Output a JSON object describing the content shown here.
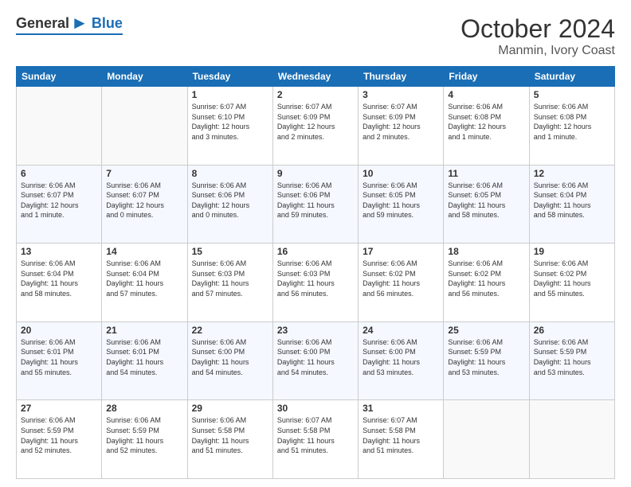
{
  "header": {
    "logo_general": "General",
    "logo_blue": "Blue",
    "month_title": "October 2024",
    "location": "Manmin, Ivory Coast"
  },
  "weekdays": [
    "Sunday",
    "Monday",
    "Tuesday",
    "Wednesday",
    "Thursday",
    "Friday",
    "Saturday"
  ],
  "weeks": [
    [
      {
        "day": "",
        "info": ""
      },
      {
        "day": "",
        "info": ""
      },
      {
        "day": "1",
        "info": "Sunrise: 6:07 AM\nSunset: 6:10 PM\nDaylight: 12 hours\nand 3 minutes."
      },
      {
        "day": "2",
        "info": "Sunrise: 6:07 AM\nSunset: 6:09 PM\nDaylight: 12 hours\nand 2 minutes."
      },
      {
        "day": "3",
        "info": "Sunrise: 6:07 AM\nSunset: 6:09 PM\nDaylight: 12 hours\nand 2 minutes."
      },
      {
        "day": "4",
        "info": "Sunrise: 6:06 AM\nSunset: 6:08 PM\nDaylight: 12 hours\nand 1 minute."
      },
      {
        "day": "5",
        "info": "Sunrise: 6:06 AM\nSunset: 6:08 PM\nDaylight: 12 hours\nand 1 minute."
      }
    ],
    [
      {
        "day": "6",
        "info": "Sunrise: 6:06 AM\nSunset: 6:07 PM\nDaylight: 12 hours\nand 1 minute."
      },
      {
        "day": "7",
        "info": "Sunrise: 6:06 AM\nSunset: 6:07 PM\nDaylight: 12 hours\nand 0 minutes."
      },
      {
        "day": "8",
        "info": "Sunrise: 6:06 AM\nSunset: 6:06 PM\nDaylight: 12 hours\nand 0 minutes."
      },
      {
        "day": "9",
        "info": "Sunrise: 6:06 AM\nSunset: 6:06 PM\nDaylight: 11 hours\nand 59 minutes."
      },
      {
        "day": "10",
        "info": "Sunrise: 6:06 AM\nSunset: 6:05 PM\nDaylight: 11 hours\nand 59 minutes."
      },
      {
        "day": "11",
        "info": "Sunrise: 6:06 AM\nSunset: 6:05 PM\nDaylight: 11 hours\nand 58 minutes."
      },
      {
        "day": "12",
        "info": "Sunrise: 6:06 AM\nSunset: 6:04 PM\nDaylight: 11 hours\nand 58 minutes."
      }
    ],
    [
      {
        "day": "13",
        "info": "Sunrise: 6:06 AM\nSunset: 6:04 PM\nDaylight: 11 hours\nand 58 minutes."
      },
      {
        "day": "14",
        "info": "Sunrise: 6:06 AM\nSunset: 6:04 PM\nDaylight: 11 hours\nand 57 minutes."
      },
      {
        "day": "15",
        "info": "Sunrise: 6:06 AM\nSunset: 6:03 PM\nDaylight: 11 hours\nand 57 minutes."
      },
      {
        "day": "16",
        "info": "Sunrise: 6:06 AM\nSunset: 6:03 PM\nDaylight: 11 hours\nand 56 minutes."
      },
      {
        "day": "17",
        "info": "Sunrise: 6:06 AM\nSunset: 6:02 PM\nDaylight: 11 hours\nand 56 minutes."
      },
      {
        "day": "18",
        "info": "Sunrise: 6:06 AM\nSunset: 6:02 PM\nDaylight: 11 hours\nand 56 minutes."
      },
      {
        "day": "19",
        "info": "Sunrise: 6:06 AM\nSunset: 6:02 PM\nDaylight: 11 hours\nand 55 minutes."
      }
    ],
    [
      {
        "day": "20",
        "info": "Sunrise: 6:06 AM\nSunset: 6:01 PM\nDaylight: 11 hours\nand 55 minutes."
      },
      {
        "day": "21",
        "info": "Sunrise: 6:06 AM\nSunset: 6:01 PM\nDaylight: 11 hours\nand 54 minutes."
      },
      {
        "day": "22",
        "info": "Sunrise: 6:06 AM\nSunset: 6:00 PM\nDaylight: 11 hours\nand 54 minutes."
      },
      {
        "day": "23",
        "info": "Sunrise: 6:06 AM\nSunset: 6:00 PM\nDaylight: 11 hours\nand 54 minutes."
      },
      {
        "day": "24",
        "info": "Sunrise: 6:06 AM\nSunset: 6:00 PM\nDaylight: 11 hours\nand 53 minutes."
      },
      {
        "day": "25",
        "info": "Sunrise: 6:06 AM\nSunset: 5:59 PM\nDaylight: 11 hours\nand 53 minutes."
      },
      {
        "day": "26",
        "info": "Sunrise: 6:06 AM\nSunset: 5:59 PM\nDaylight: 11 hours\nand 53 minutes."
      }
    ],
    [
      {
        "day": "27",
        "info": "Sunrise: 6:06 AM\nSunset: 5:59 PM\nDaylight: 11 hours\nand 52 minutes."
      },
      {
        "day": "28",
        "info": "Sunrise: 6:06 AM\nSunset: 5:59 PM\nDaylight: 11 hours\nand 52 minutes."
      },
      {
        "day": "29",
        "info": "Sunrise: 6:06 AM\nSunset: 5:58 PM\nDaylight: 11 hours\nand 51 minutes."
      },
      {
        "day": "30",
        "info": "Sunrise: 6:07 AM\nSunset: 5:58 PM\nDaylight: 11 hours\nand 51 minutes."
      },
      {
        "day": "31",
        "info": "Sunrise: 6:07 AM\nSunset: 5:58 PM\nDaylight: 11 hours\nand 51 minutes."
      },
      {
        "day": "",
        "info": ""
      },
      {
        "day": "",
        "info": ""
      }
    ]
  ]
}
